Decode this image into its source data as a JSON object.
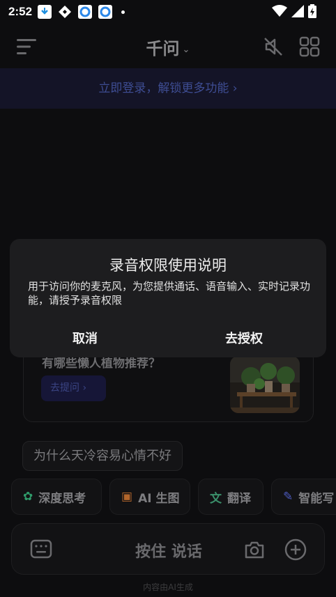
{
  "status_bar": {
    "time": "2:52"
  },
  "header": {
    "title": "千问",
    "title_chevron": "⌄"
  },
  "login_banner": {
    "text": "立即登录，解锁更多功能 ›"
  },
  "card": {
    "question": "有哪些懒人植物推荐？",
    "ask_button": "去提问 ›"
  },
  "suggestion": "为什么天冷容易心情不好",
  "chips": [
    {
      "label": "深度思考",
      "icon": "atom-icon",
      "color": "#2f9b6a"
    },
    {
      "label": "AI 生图",
      "icon": "image-gen-icon",
      "color": "#b3662b"
    },
    {
      "label": "翻译",
      "icon": "translate-icon",
      "color": "#3a8f6a"
    },
    {
      "label": "智能写",
      "icon": "pen-icon",
      "color": "#4d5bc0"
    }
  ],
  "input_bar": {
    "hold_to_talk": "按住 说话"
  },
  "footer": "内容由AI生成",
  "dialog": {
    "title": "录音权限使用说明",
    "message": "用于访问你的麦克风，为您提供通话、语音输入、实时记录功能，请授予录音权限",
    "cancel": "取消",
    "grant": "去授权"
  }
}
